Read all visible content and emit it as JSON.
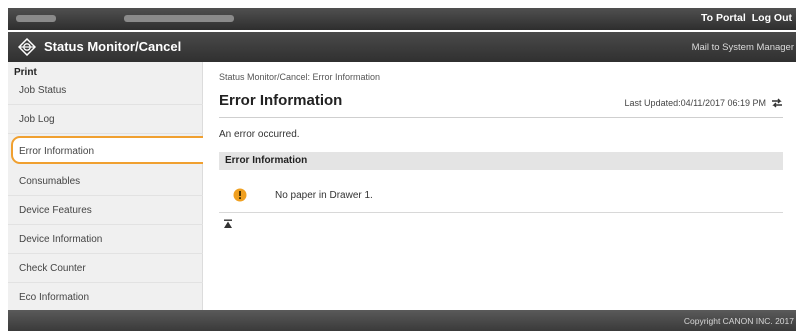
{
  "header": {
    "links": [
      "To Portal",
      "Log Out"
    ]
  },
  "titlebar": {
    "icon": "status-monitor-icon",
    "title": "Status Monitor/Cancel",
    "mail_link": "Mail to System Manager"
  },
  "sidebar": {
    "group_label": "Print",
    "items": [
      {
        "label": "Job Status"
      },
      {
        "label": "Job Log"
      },
      {
        "label": "Error Information",
        "selected": true
      },
      {
        "label": "Consumables"
      },
      {
        "label": "Device Features"
      },
      {
        "label": "Device Information"
      },
      {
        "label": "Check Counter"
      },
      {
        "label": "Eco Information"
      }
    ],
    "highlight_color": "#f0a030"
  },
  "main": {
    "breadcrumb": "Status Monitor/Cancel: Error Information",
    "title": "Error Information",
    "last_updated": "Last Updated:04/11/2017 06:19 PM",
    "message": "An error occurred.",
    "section_title": "Error Information",
    "errors": [
      {
        "icon": "warning-icon",
        "text": "No paper in Drawer 1."
      }
    ],
    "warning_color": "#f0a020"
  },
  "footer": {
    "copyright": "Copyright CANON INC. 2017"
  }
}
